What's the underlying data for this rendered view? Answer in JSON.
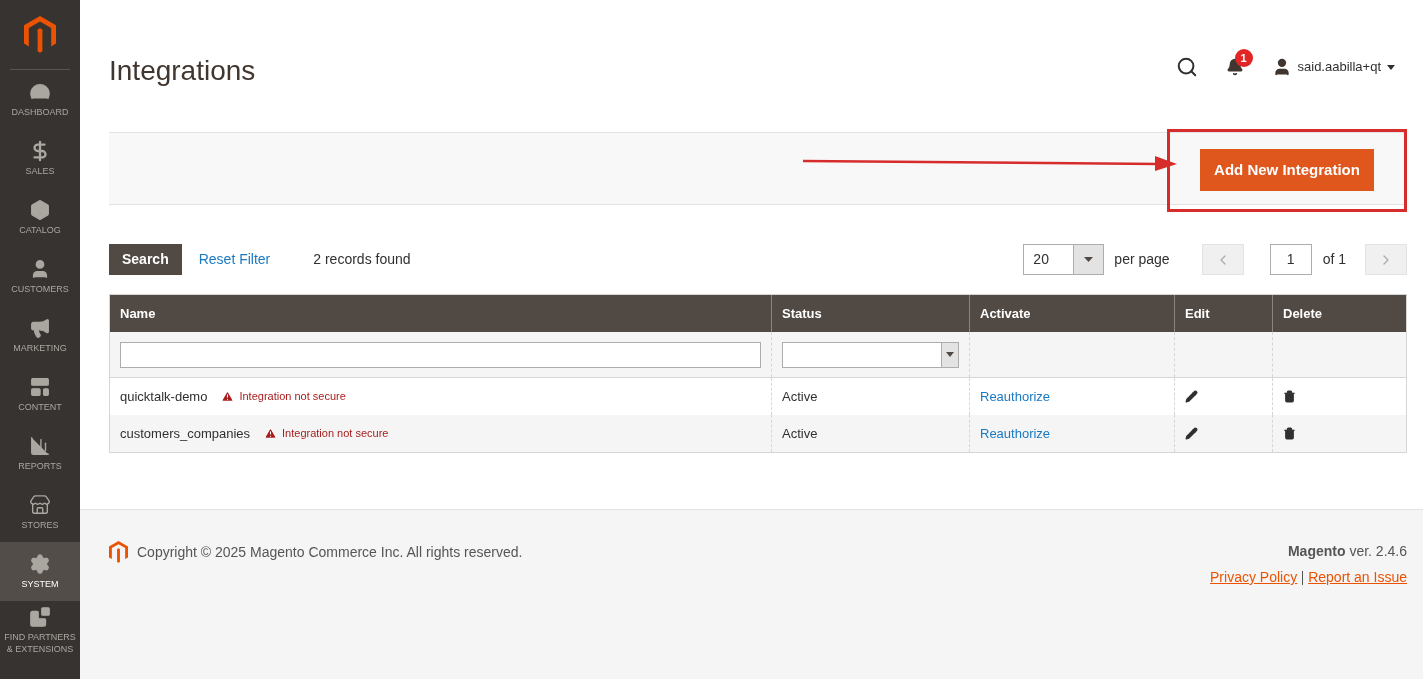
{
  "sidebar": {
    "items": [
      {
        "label": "DASHBOARD",
        "selected": false
      },
      {
        "label": "SALES",
        "selected": false
      },
      {
        "label": "CATALOG",
        "selected": false
      },
      {
        "label": "CUSTOMERS",
        "selected": false
      },
      {
        "label": "MARKETING",
        "selected": false
      },
      {
        "label": "CONTENT",
        "selected": false
      },
      {
        "label": "REPORTS",
        "selected": false
      },
      {
        "label": "STORES",
        "selected": false
      },
      {
        "label": "SYSTEM",
        "selected": true
      },
      {
        "label": "FIND PARTNERS & EXTENSIONS",
        "selected": false
      }
    ]
  },
  "header": {
    "title": "Integrations",
    "notifications": "1",
    "user": "said.aabilla+qt"
  },
  "actions": {
    "primary_button": "Add New Integration"
  },
  "toolbar": {
    "search_button": "Search",
    "reset_link": "Reset Filter",
    "records": "2 records found",
    "per_page_value": "20",
    "per_page_label": "per page",
    "page": "1",
    "of_pages": "of 1"
  },
  "table": {
    "columns": [
      "Name",
      "Status",
      "Activate",
      "Edit",
      "Delete"
    ],
    "rows": [
      {
        "name": "quicktalk-demo",
        "warning": "Integration not secure",
        "status": "Active",
        "activate": "Reauthorize"
      },
      {
        "name": "customers_companies",
        "warning": "Integration not secure",
        "status": "Active",
        "activate": "Reauthorize"
      }
    ]
  },
  "footer": {
    "copyright": "Copyright © 2025 Magento Commerce Inc. All rights reserved.",
    "version": "**Magento** ver. 2.4.6",
    "links": [
      "Privacy Policy",
      "Report an Issue"
    ]
  }
}
